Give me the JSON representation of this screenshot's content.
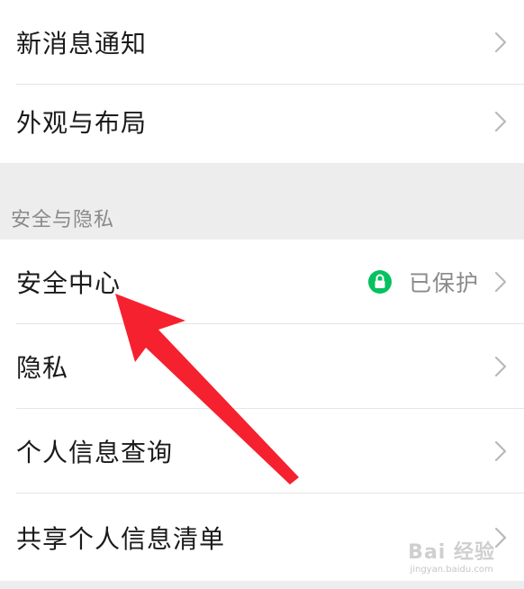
{
  "settings": {
    "top_items": [
      {
        "label": "新消息通知"
      },
      {
        "label": "外观与布局"
      }
    ],
    "security_section": {
      "title": "安全与隐私",
      "items": [
        {
          "label": "安全中心",
          "status": "已保护"
        },
        {
          "label": "隐私"
        },
        {
          "label": "个人信息查询"
        },
        {
          "label": "共享个人信息清单"
        }
      ]
    }
  },
  "watermark": {
    "logo": "Bai 经验",
    "url": "jingyan.baidu.com"
  },
  "colors": {
    "background": "#ededed",
    "card": "#ffffff",
    "lock_badge": "#07c160",
    "annotation_arrow": "#f5212e"
  },
  "icons": {
    "chevron": "chevron-right-icon",
    "lock": "lock-icon",
    "arrow": "annotation-arrow-icon"
  }
}
